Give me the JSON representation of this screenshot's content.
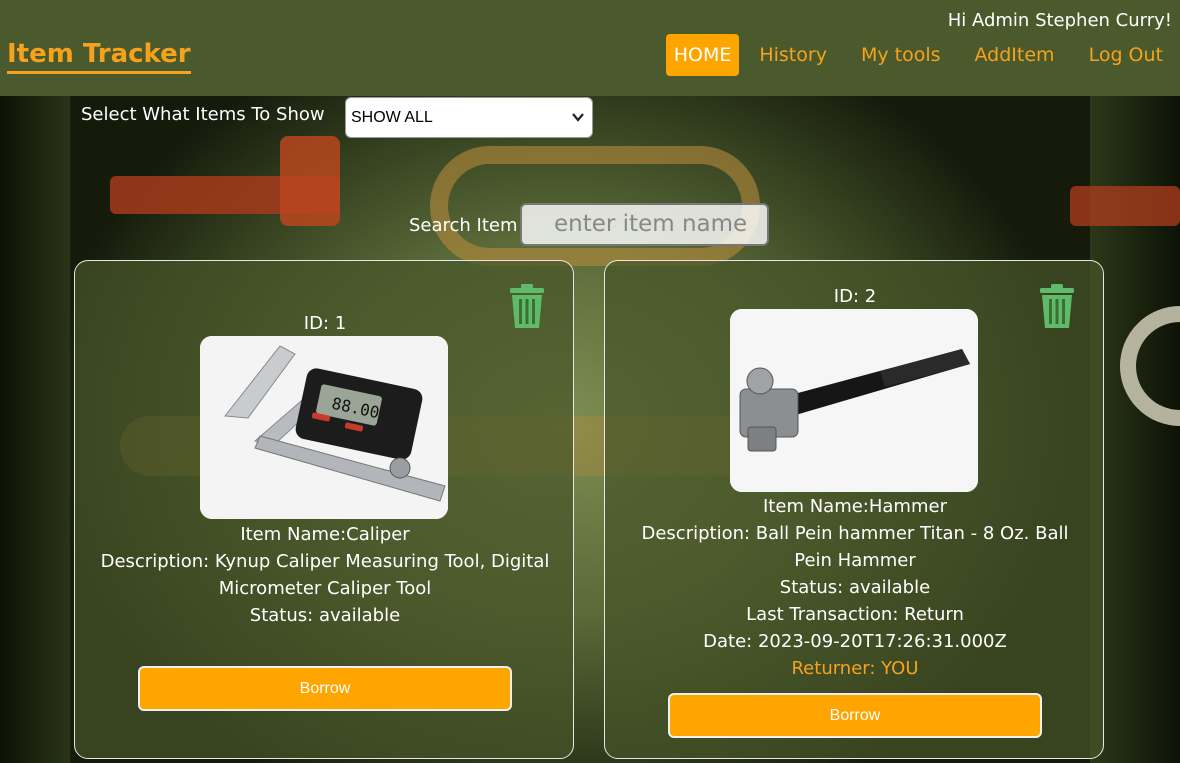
{
  "navbar": {
    "brand": "Item Tracker",
    "greeting": "Hi Admin Stephen Curry!",
    "items": [
      {
        "label": "HOME",
        "active": true
      },
      {
        "label": "History"
      },
      {
        "label": "My tools"
      },
      {
        "label": "AddItem"
      },
      {
        "label": "Log Out"
      }
    ]
  },
  "filter": {
    "label": "Select What Items To Show",
    "selected": "SHOW ALL"
  },
  "search": {
    "label": "Search Item",
    "placeholder": "enter item name"
  },
  "colors": {
    "accent": "#ffa500",
    "brand": "#f6a21c",
    "trash": "#5fba6a",
    "navbar": "#4a5a2c"
  },
  "items": [
    {
      "id": "ID: 1",
      "image_icon": "caliper-image",
      "name": "Item Name:Caliper",
      "description": "Description: Kynup Caliper Measuring Tool, Digital Micrometer Caliper Tool",
      "status": "Status: available",
      "button": "Borrow"
    },
    {
      "id": "ID: 2",
      "image_icon": "hammer-image",
      "name": "Item Name:Hammer",
      "description": "Description: Ball Pein hammer Titan - 8 Oz. Ball Pein Hammer",
      "status": "Status: available",
      "last_transaction": "Last Transaction: Return",
      "date": "Date: 2023-09-20T17:26:31.000Z",
      "returner": "Returner: YOU",
      "button": "Borrow"
    }
  ],
  "caliper_display": "88.00"
}
